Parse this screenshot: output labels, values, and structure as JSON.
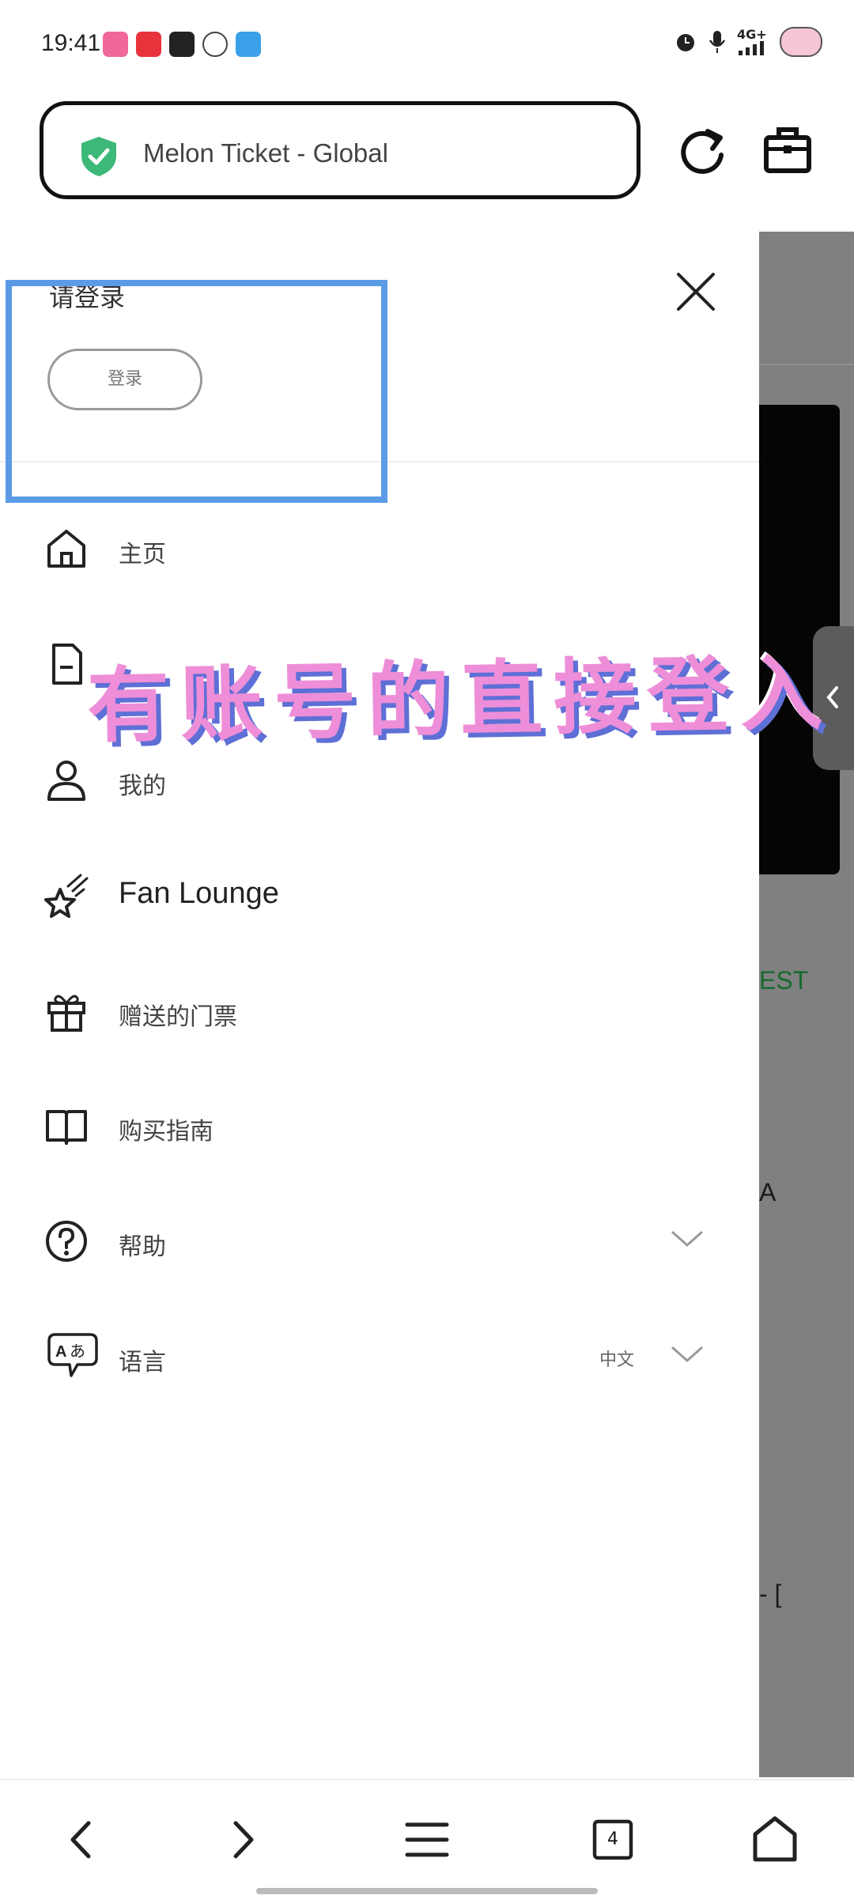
{
  "status_bar": {
    "time": "19:41",
    "network_label": "4G+",
    "app_icon_colors": [
      "#f0679a",
      "#e8323c",
      "#222222",
      "#555555",
      "#3aa0e8"
    ]
  },
  "browser": {
    "url_title": "Melon Ticket - Global",
    "secure_icon": "shield-check-icon",
    "secure_color": "#3cb878"
  },
  "drawer": {
    "login_prompt": "请登录",
    "login_button": "登录",
    "menu": [
      {
        "icon": "home-icon",
        "label": "主页"
      },
      {
        "icon": "document-icon",
        "label": ""
      },
      {
        "icon": "user-icon",
        "label": "我的"
      },
      {
        "icon": "star-icon",
        "label": "Fan Lounge"
      },
      {
        "icon": "gift-icon",
        "label": "赠送的门票"
      },
      {
        "icon": "book-icon",
        "label": "购买指南"
      },
      {
        "icon": "help-icon",
        "label": "帮助"
      },
      {
        "icon": "language-icon",
        "label": "语言",
        "value": "中文"
      }
    ]
  },
  "overlay": {
    "caption": "有账号的直接登入"
  },
  "background_page": {
    "fragment_1": "EST",
    "fragment_2": "A",
    "fragment_3": "- ["
  },
  "bottom_nav": {
    "tab_count": "4"
  },
  "colors": {
    "highlight": "#5b9be6",
    "caption": "#ee8ed8",
    "caption_shadow": "#5e6fd6",
    "backdrop": "#808080"
  }
}
